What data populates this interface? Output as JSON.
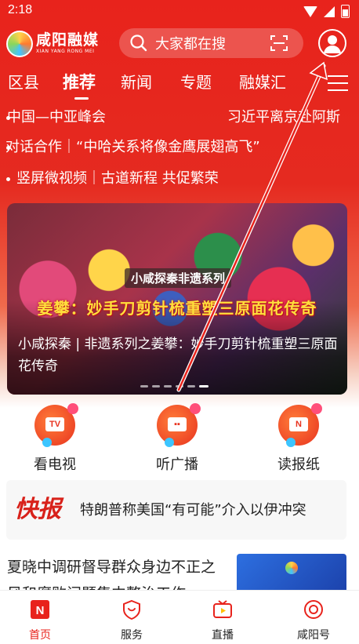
{
  "status_bar": {
    "time": "2:18"
  },
  "header": {
    "logo": {
      "title": "咸阳融媒",
      "pinyin": "XIAN YANG RONG MEI"
    },
    "search_placeholder": "大家都在搜",
    "icons": [
      "search-icon",
      "scan-icon",
      "user-icon"
    ]
  },
  "tabs": [
    {
      "label": "区县"
    },
    {
      "label": "推荐",
      "active": true
    },
    {
      "label": "新闻"
    },
    {
      "label": "专题"
    },
    {
      "label": "融媒汇"
    }
  ],
  "headlines": [
    {
      "text": "中国—中亚峰会"
    },
    {
      "text": "习近平离京赴阿斯"
    },
    {
      "text": "对话合作｜“中哈关系将像金鹰展翅高飞”"
    },
    {
      "text": "竖屏微视频｜古道新程 共促繁荣"
    }
  ],
  "banner": {
    "tag": "小咸探秦非遗系列",
    "headline": "姜攀：妙手刀剪针梳重塑三原面花传奇",
    "caption": "小咸探秦 | 非遗系列之姜攀：妙手刀剪针梳重塑三原面花传奇",
    "dots_count": 6,
    "active_dot": 6
  },
  "quick_links": [
    {
      "label": "看电视",
      "icon": "tv-icon",
      "glyph": "TV"
    },
    {
      "label": "听广播",
      "icon": "radio-icon",
      "glyph": "▪▪"
    },
    {
      "label": "读报纸",
      "icon": "newspaper-icon",
      "glyph": "N"
    }
  ],
  "flash_news": {
    "logo": "快报",
    "text": "特朗普称美国“有可能”介入以伊冲突"
  },
  "article": {
    "title": "夏晓中调研督导群众身边不正之风和腐败问题集中整治工作"
  },
  "bottom_nav": [
    {
      "label": "首页",
      "icon": "home-icon",
      "active": true
    },
    {
      "label": "服务",
      "icon": "service-icon"
    },
    {
      "label": "直播",
      "icon": "live-icon"
    },
    {
      "label": "咸阳号",
      "icon": "xianyang-icon"
    }
  ],
  "colors": {
    "brand_red": "#e8231c",
    "headline_yellow": "#ffdf3c"
  }
}
